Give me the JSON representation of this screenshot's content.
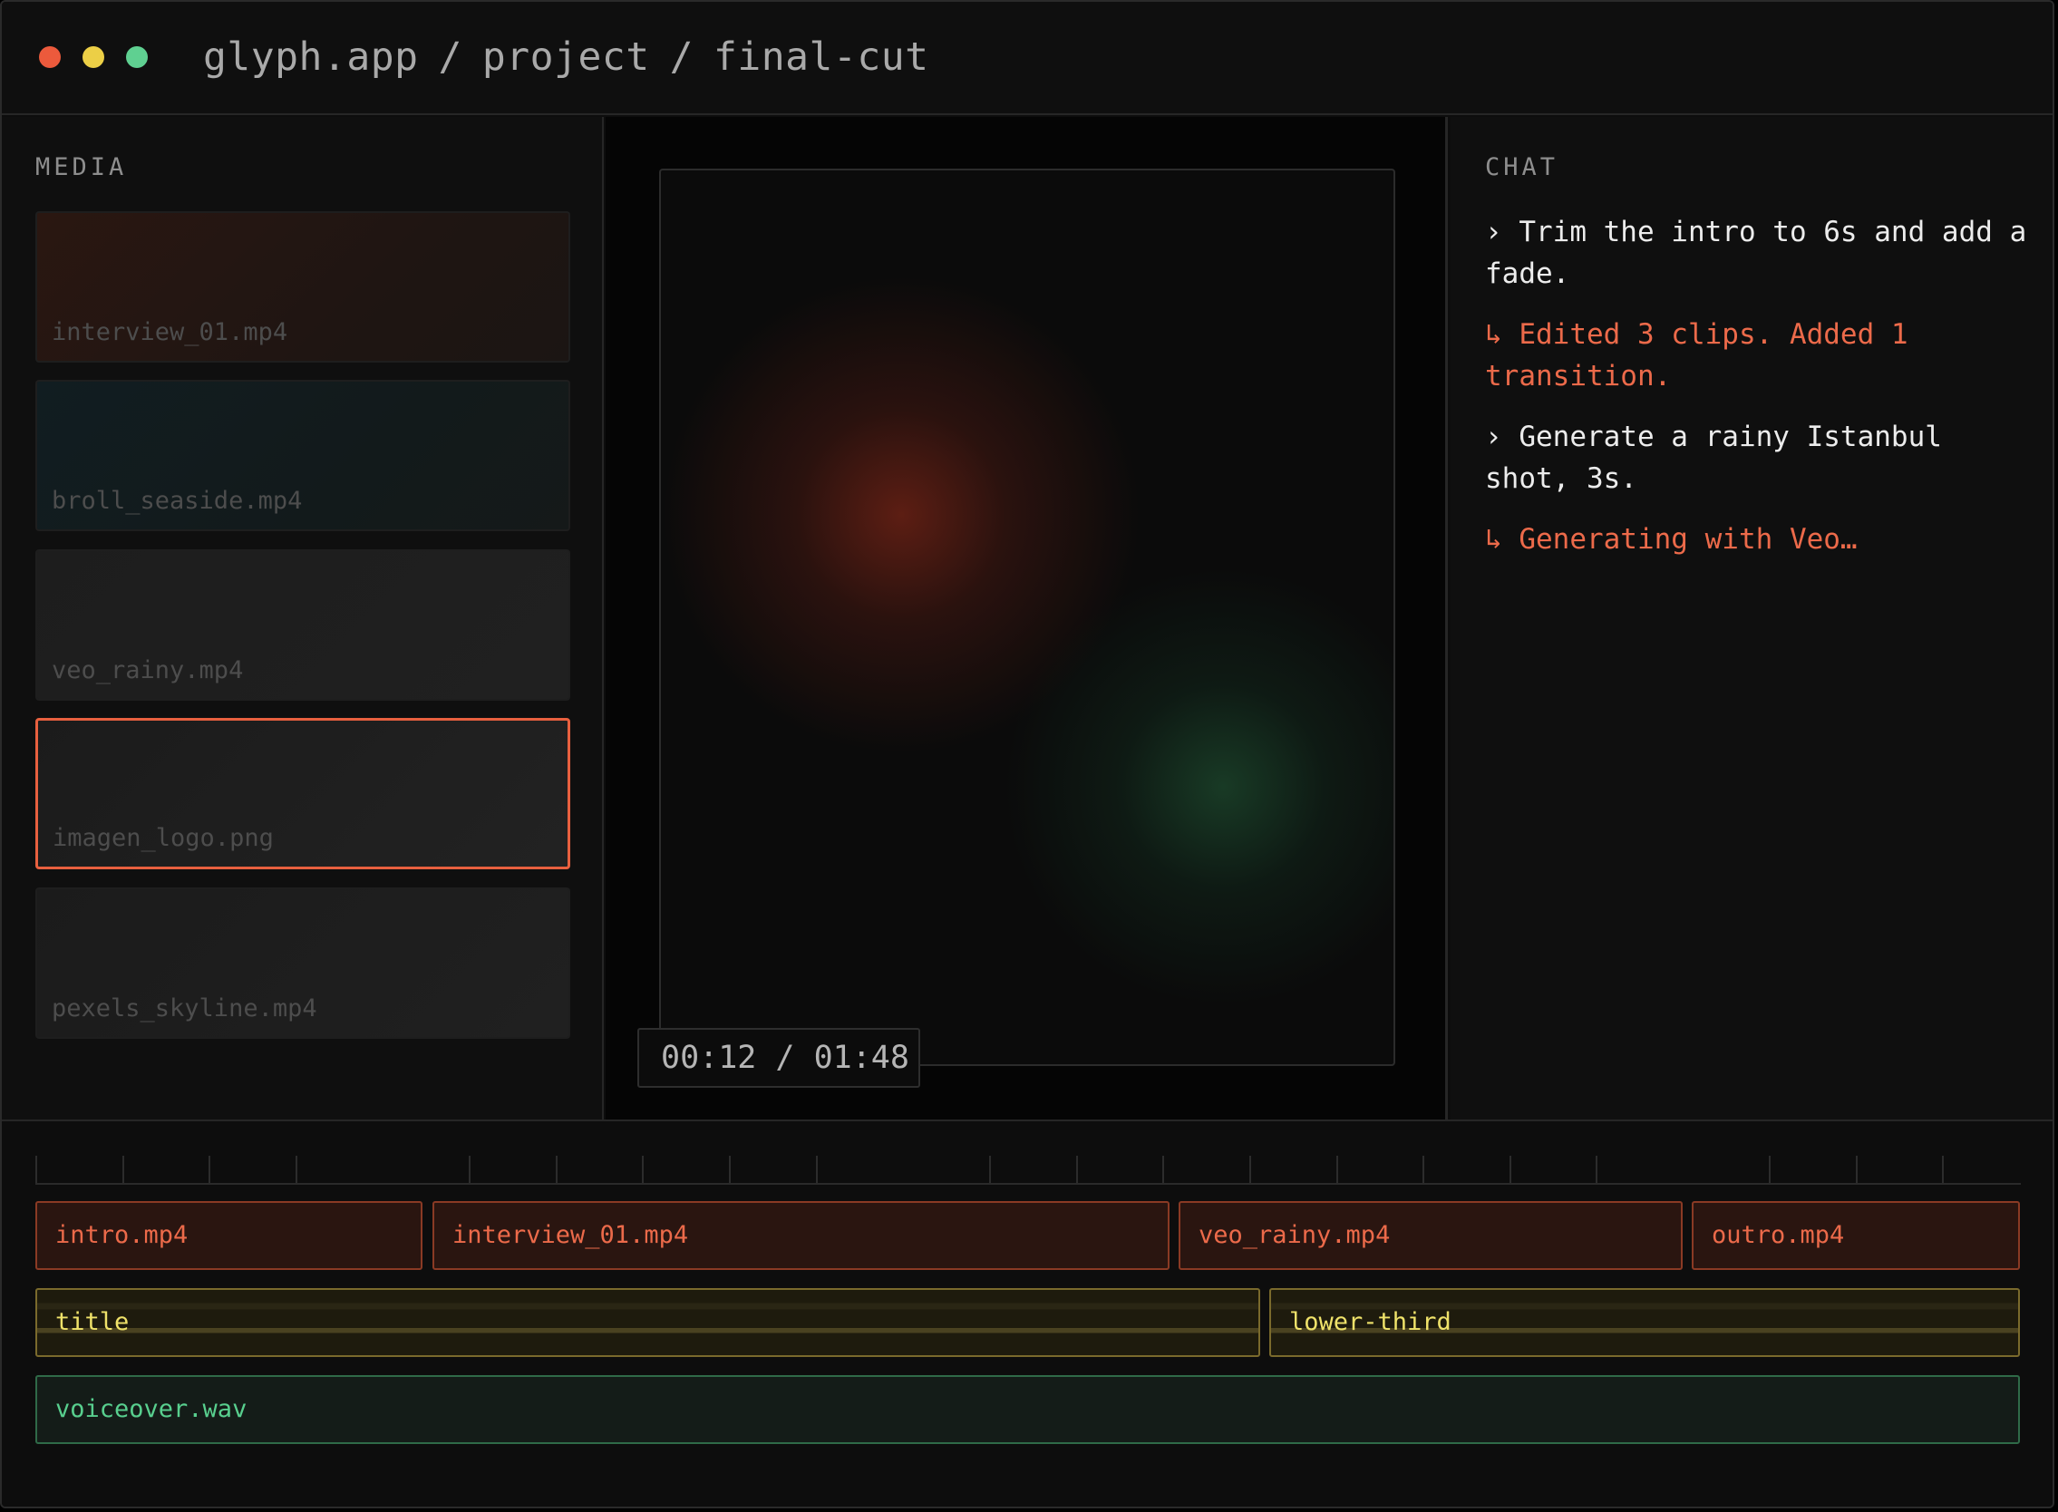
{
  "window": {
    "breadcrumb": [
      "glyph.app",
      "project",
      "final-cut"
    ],
    "breadcrumb_sep": "/"
  },
  "media": {
    "title": "MEDIA",
    "items": [
      {
        "name": "interview_01.mp4"
      },
      {
        "name": "broll_seaside.mp4"
      },
      {
        "name": "veo_rainy.mp4"
      },
      {
        "name": "imagen_logo.png",
        "selected": true
      },
      {
        "name": "pexels_skyline.mp4"
      }
    ]
  },
  "preview": {
    "timecode": "00:12 / 01:48"
  },
  "chat": {
    "title": "CHAT",
    "messages": [
      {
        "role": "user",
        "text": "› Trim the intro to 6s and add a fade."
      },
      {
        "role": "agent",
        "text": "↳ Edited 3 clips. Added 1 transition."
      },
      {
        "role": "user",
        "text": "› Generate a rainy Istanbul shot, 3s."
      },
      {
        "role": "agent",
        "text": "↳ Generating with Veo…"
      }
    ]
  },
  "timeline": {
    "video_track": [
      "intro.mp4",
      "interview_01.mp4",
      "veo_rainy.mp4",
      "outro.mp4"
    ],
    "text_track": [
      "title",
      "lower-third"
    ],
    "audio_track": [
      "voiceover.wav"
    ]
  },
  "colors": {
    "accent": "#ec6a4a",
    "traffic_red": "#ec5a3c",
    "traffic_yellow": "#eccf46",
    "traffic_green": "#5fd091",
    "text_track": "#efe26a",
    "audio_track": "#58cf8e"
  }
}
